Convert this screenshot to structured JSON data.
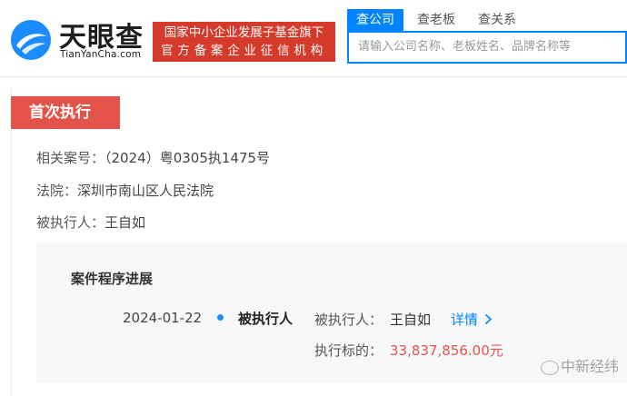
{
  "header": {
    "logo_text": "天眼查",
    "logo_sub": "TianYanCha.com",
    "fund_line1": "国家中小企业发展子基金旗下",
    "fund_line2": "官方备案企业征信机构",
    "tabs": [
      {
        "label": "查公司",
        "active": true
      },
      {
        "label": "查老板",
        "active": false
      },
      {
        "label": "查关系",
        "active": false
      }
    ],
    "search_placeholder": "请输入公司名称、老板姓名、品牌名称等"
  },
  "section": {
    "tag": "首次执行",
    "case_label": "相关案号：",
    "case_value": "（2024）粤0305执1475号",
    "court_label": "法院：",
    "court_value": "深圳市南山区人民法院",
    "party_label": "被执行人：",
    "party_value": "王自如"
  },
  "progress": {
    "title": "案件程序进展",
    "date": "2024-01-22",
    "role": "被执行人",
    "exe_label": "被执行人：",
    "exe_name": "王自如",
    "detail_link": "详情",
    "amount_label": "执行标的：",
    "amount": "33,837,856.00元"
  },
  "watermark": "中新经纬",
  "colors": {
    "brand_blue": "#0084ff",
    "badge_red": "#d63a2a",
    "tag_red": "#e4534a"
  }
}
